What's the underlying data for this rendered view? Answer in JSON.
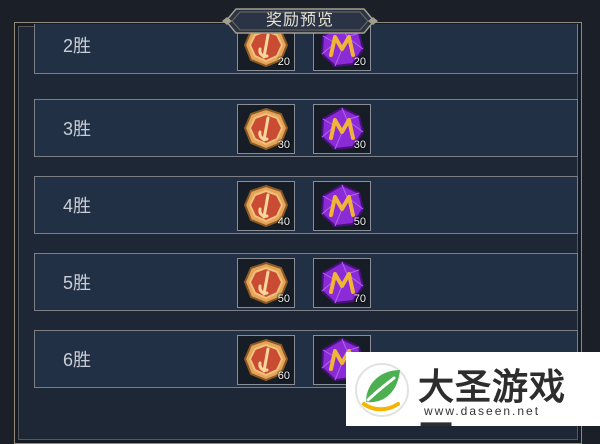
{
  "title": "奖励预览",
  "rewards": [
    {
      "label": "2胜",
      "coin_qty": "20",
      "gem_qty": "20"
    },
    {
      "label": "3胜",
      "coin_qty": "30",
      "gem_qty": "30"
    },
    {
      "label": "4胜",
      "coin_qty": "40",
      "gem_qty": "50"
    },
    {
      "label": "5胜",
      "coin_qty": "50",
      "gem_qty": "70"
    },
    {
      "label": "6胜",
      "coin_qty": "60",
      "gem_qty": ""
    }
  ],
  "icons": {
    "coin": "gold-coin-icon",
    "gem": "purple-m-gem-icon"
  },
  "colors": {
    "panel_bg": "#1d2735",
    "row_bg": "#223045",
    "coin": "#d9974a",
    "gem": "#8b2bd6"
  },
  "watermark": {
    "brand": "大圣游戏网",
    "url": "www.daseen.net"
  }
}
